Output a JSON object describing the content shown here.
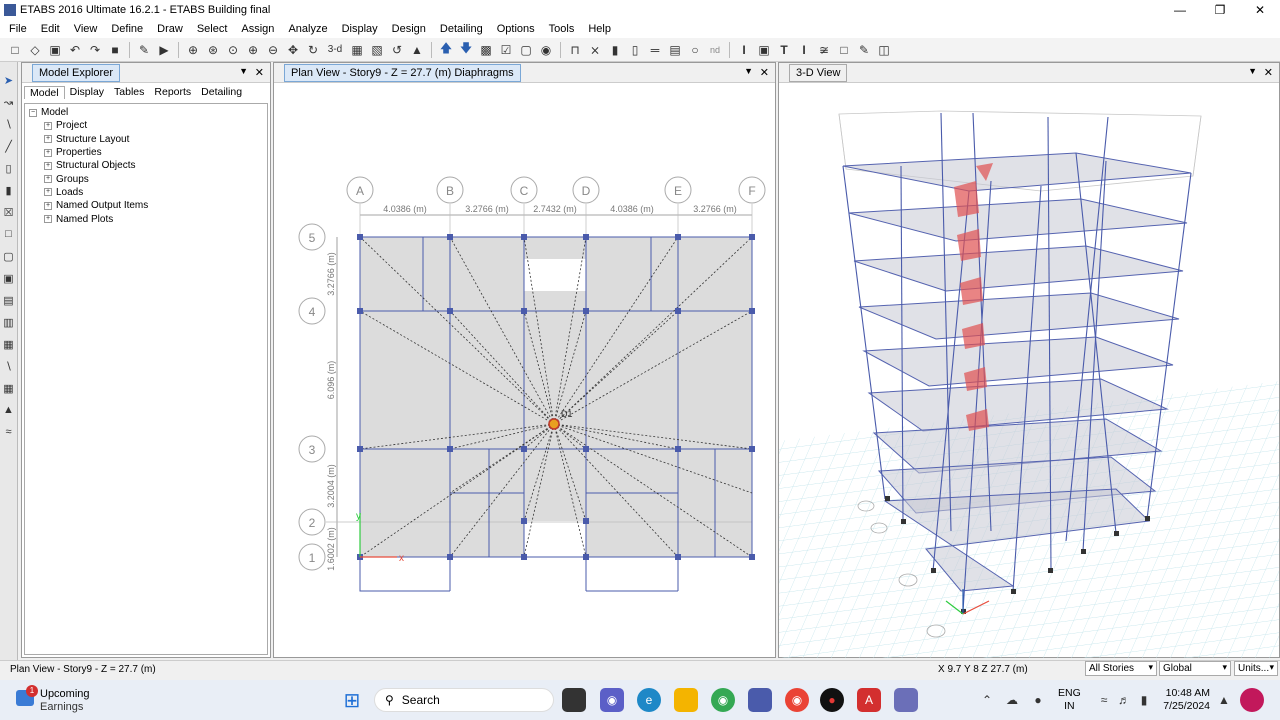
{
  "window": {
    "title": "ETABS 2016 Ultimate 16.2.1 - ETABS Building final",
    "minimize": "—",
    "maximize": "❐",
    "close": "✕"
  },
  "menu": [
    "File",
    "Edit",
    "View",
    "Define",
    "Draw",
    "Select",
    "Assign",
    "Analyze",
    "Display",
    "Design",
    "Detailing",
    "Options",
    "Tools",
    "Help"
  ],
  "toolbar": {
    "label_3d": "3-d",
    "label_nd": "nd"
  },
  "model_explorer": {
    "title": "Model Explorer",
    "tabs": [
      "Model",
      "Display",
      "Tables",
      "Reports",
      "Detailing"
    ],
    "root": "Model",
    "items": [
      "Project",
      "Structure Layout",
      "Properties",
      "Structural Objects",
      "Groups",
      "Loads",
      "Named Output Items",
      "Named Plots"
    ]
  },
  "plan_view": {
    "title": "Plan View - Story9 - Z = 27.7 (m)  Diaphragms",
    "grid_x": [
      "A",
      "B",
      "C",
      "D",
      "E",
      "F"
    ],
    "grid_y": [
      "5",
      "4",
      "3",
      "2",
      "1"
    ],
    "dims_x": [
      "4.0386 (m)",
      "3.2766 (m)",
      "2.7432 (m)",
      "4.0386 (m)",
      "3.2766 (m)"
    ],
    "dims_y": [
      "3.2766 (m)",
      "6.096 (m)",
      "3.2004 (m)",
      "1.6002 (m)"
    ],
    "diaphragm_label": "D1"
  },
  "view3d": {
    "title": "3-D View"
  },
  "status": {
    "left": "Plan View - Story9 - Z = 27.7 (m)",
    "coords": "X 9.7  Y 8  Z 27.7 (m)",
    "stories": "All Stories",
    "coord_sys": "Global",
    "units": "Units..."
  },
  "taskbar": {
    "weather_title": "Upcoming",
    "weather_sub": "Earnings",
    "weather_badge": "1",
    "search": "Search",
    "lang1": "ENG",
    "lang2": "IN",
    "time": "10:48 AM",
    "date": "7/25/2024"
  }
}
